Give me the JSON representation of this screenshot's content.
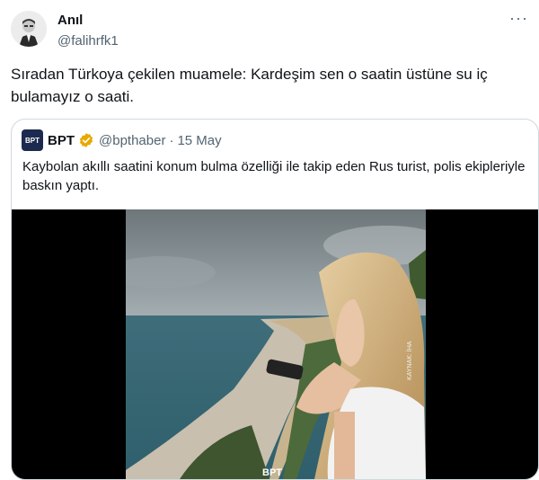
{
  "author": {
    "name": "Anıl",
    "handle": "@falihrfk1"
  },
  "more_label": "···",
  "tweet": {
    "text": "Sıradan Türkoya çekilen muamele: Kardeşim sen o saatin üstüne su iç bulamayız o saati."
  },
  "quote": {
    "logo_text": "BPT",
    "name": "BPT",
    "handle": "@bpthaber",
    "separator": "·",
    "date": "15 May",
    "text": "Kaybolan akıllı saatini konum bulma özelliği ile takip eden Rus turist, polis ekipleriyle baskın yaptı."
  },
  "media": {
    "watermark": "KAYNAK: İHA",
    "bottom_logo": "BPT"
  },
  "colors": {
    "verified": "#f4b400",
    "link_gray": "#536471",
    "border": "#cfd9de"
  }
}
